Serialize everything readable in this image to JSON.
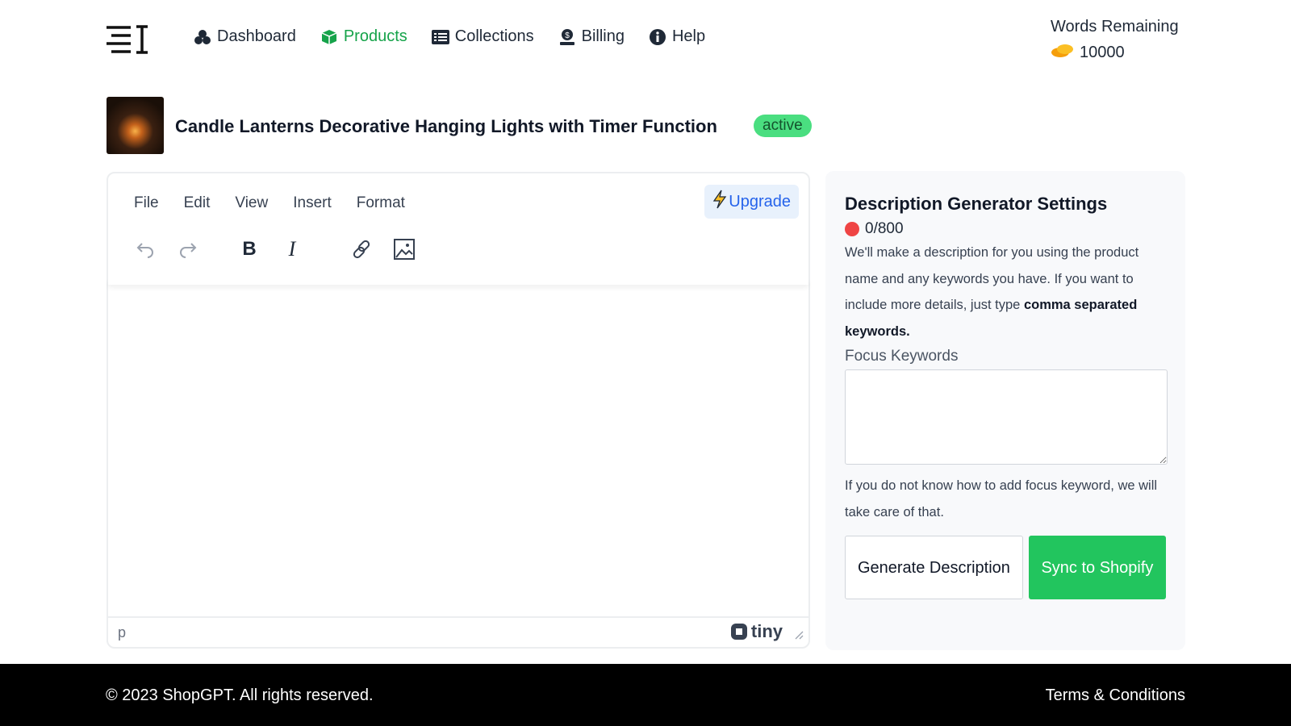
{
  "nav": {
    "items": [
      {
        "label": "Dashboard",
        "icon": "cubes-icon"
      },
      {
        "label": "Products",
        "icon": "box-icon",
        "active": true
      },
      {
        "label": "Collections",
        "icon": "list-icon"
      },
      {
        "label": "Billing",
        "icon": "money-icon"
      },
      {
        "label": "Help",
        "icon": "info-icon"
      }
    ]
  },
  "words": {
    "label": "Words Remaining",
    "count": "10000"
  },
  "product": {
    "title": "Candle Lanterns Decorative Hanging Lights with Timer Function",
    "status": "active"
  },
  "editor": {
    "menu": [
      "File",
      "Edit",
      "View",
      "Insert",
      "Format"
    ],
    "upgrade": "Upgrade",
    "path": "p",
    "brand": "tiny"
  },
  "settings": {
    "title": "Description Generator Settings",
    "counter": "0/800",
    "desc_plain": "We'll make a description for you using the product name and any keywords you have. If you want to include more details, just type ",
    "desc_bold": "comma separated keywords.",
    "keywords_label": "Focus Keywords",
    "help": "If you do not know how to add focus keyword, we will take care of that.",
    "generate": "Generate Description",
    "sync": "Sync to Shopify"
  },
  "footer": {
    "copyright": "© 2023 ShopGPT. All rights reserved.",
    "terms": "Terms & Conditions"
  },
  "colors": {
    "accent": "#16a34a",
    "sync": "#22c55e",
    "badge": "#4ade80",
    "counter_dot": "#ef4444"
  }
}
